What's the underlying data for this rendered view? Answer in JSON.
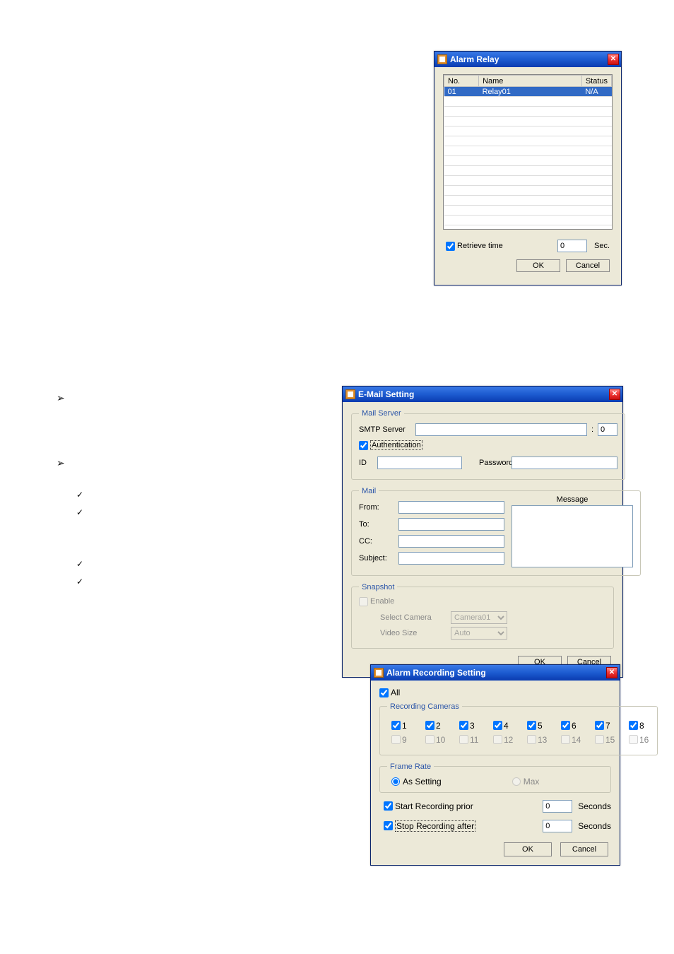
{
  "bullets": {
    "arrow": "➢",
    "check": "✓"
  },
  "alarm_relay": {
    "title": "Alarm Relay",
    "headers": {
      "no": "No.",
      "name": "Name",
      "status": "Status"
    },
    "row": {
      "no": "01",
      "name": "Relay01",
      "status": "N/A"
    },
    "retrieve_label": "Retrieve time",
    "retrieve_value": "0",
    "sec": "Sec.",
    "ok": "OK",
    "cancel": "Cancel"
  },
  "email": {
    "title": "E-Mail Setting",
    "mail_server": "Mail Server",
    "smtp_label": "SMTP Server",
    "smtp_value": "",
    "port_value": "0",
    "port_sep": ":",
    "auth_label": "Authentication",
    "id_label": "ID",
    "id_value": "",
    "pw_label": "Password",
    "pw_value": "",
    "mail_group": "Mail",
    "message_label": "Message",
    "from_label": "From:",
    "to_label": "To:",
    "cc_label": "CC:",
    "subject_label": "Subject:",
    "snapshot": "Snapshot",
    "enable": "Enable",
    "select_camera": "Select Camera",
    "camera_value": "Camera01",
    "video_size": "Video Size",
    "size_value": "Auto",
    "ok": "OK",
    "cancel": "Cancel"
  },
  "rec": {
    "title": "Alarm Recording Setting",
    "all": "All",
    "group": "Recording Cameras",
    "cams_enabled": [
      "1",
      "2",
      "3",
      "4",
      "5",
      "6",
      "7",
      "8"
    ],
    "cams_disabled": [
      "9",
      "10",
      "11",
      "12",
      "13",
      "14",
      "15",
      "16"
    ],
    "frame_group": "Frame Rate",
    "as_setting": "As Setting",
    "max": "Max",
    "start_label": "Start Recording prior",
    "start_value": "0",
    "stop_label": "Stop Recording after",
    "stop_value": "0",
    "seconds": "Seconds",
    "ok": "OK",
    "cancel": "Cancel"
  }
}
